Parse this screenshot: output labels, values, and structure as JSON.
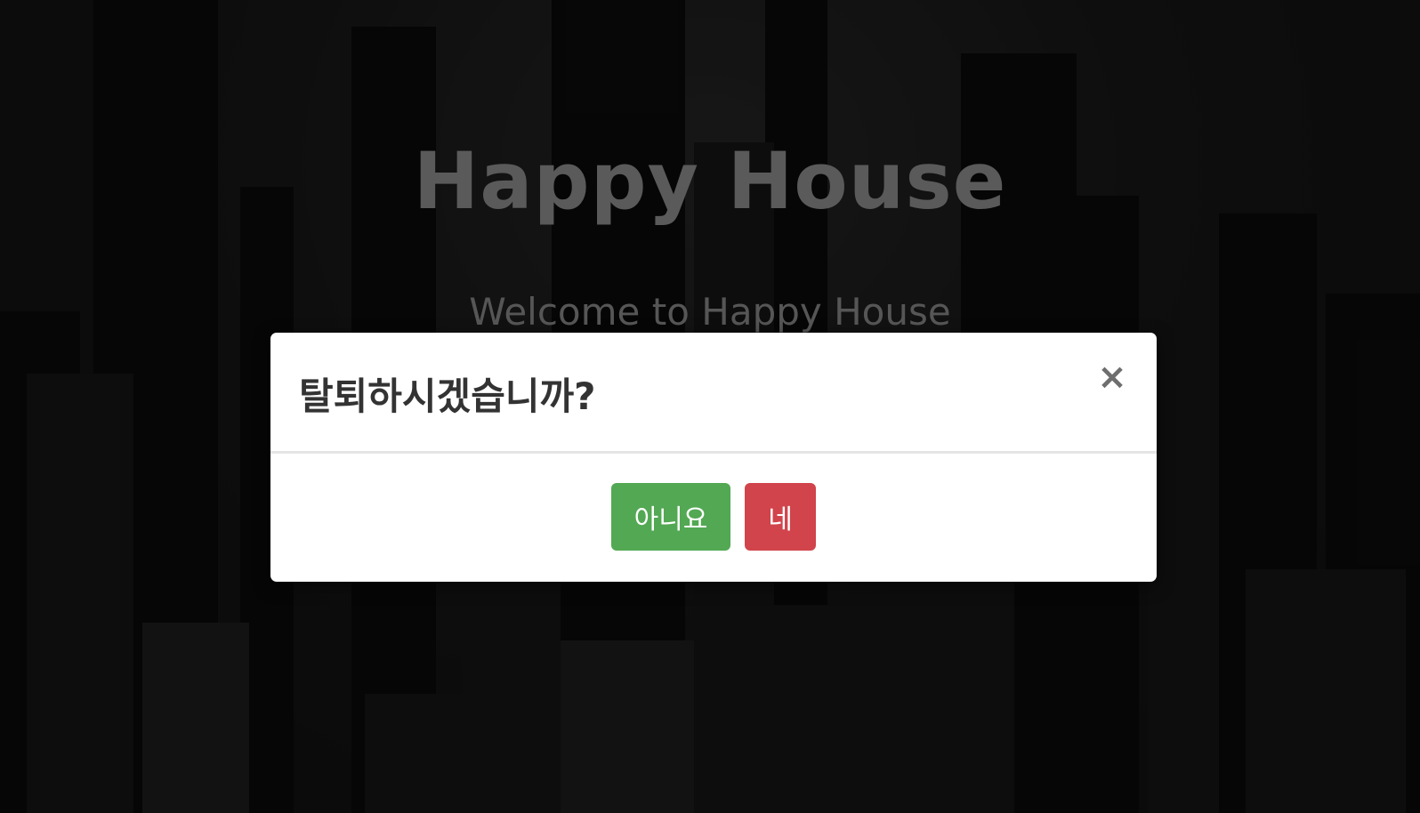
{
  "hero": {
    "title": "Happy House",
    "subtitle": "Welcome to Happy House"
  },
  "modal": {
    "title": "탈퇴하시겠습니까?",
    "close_symbol": "×",
    "buttons": {
      "no_label": "아니요",
      "yes_label": "네"
    }
  },
  "colors": {
    "no_button": "#53a853",
    "yes_button": "#d1444b",
    "modal_bg": "#ffffff"
  },
  "icons": {
    "close": "close-icon"
  }
}
